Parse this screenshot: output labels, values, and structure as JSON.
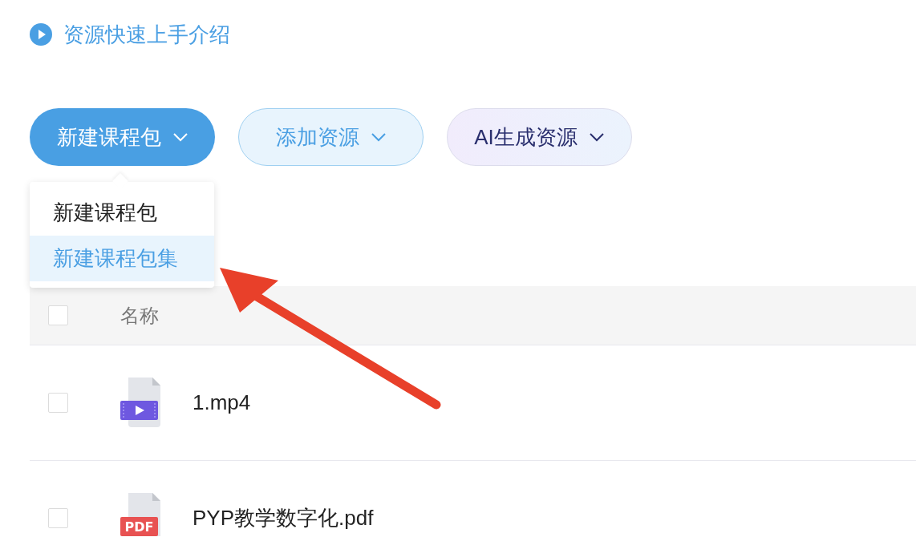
{
  "intro_link": {
    "label": "资源快速上手介绍"
  },
  "toolbar": {
    "buttons": [
      {
        "label": "新建课程包",
        "kind": "primary"
      },
      {
        "label": "添加资源",
        "kind": "light"
      },
      {
        "label": "AI生成资源",
        "kind": "ai"
      }
    ]
  },
  "dropdown": {
    "items": [
      {
        "label": "新建课程包",
        "selected": false
      },
      {
        "label": "新建课程包集",
        "selected": true
      }
    ]
  },
  "table": {
    "header": {
      "checked": false,
      "columns": [
        "名称"
      ]
    },
    "rows": [
      {
        "kind": "video",
        "name": "1.mp4",
        "checked": false
      },
      {
        "kind": "pdf",
        "badge": "PDF",
        "name": "PYP教学数字化.pdf",
        "checked": false
      }
    ]
  }
}
